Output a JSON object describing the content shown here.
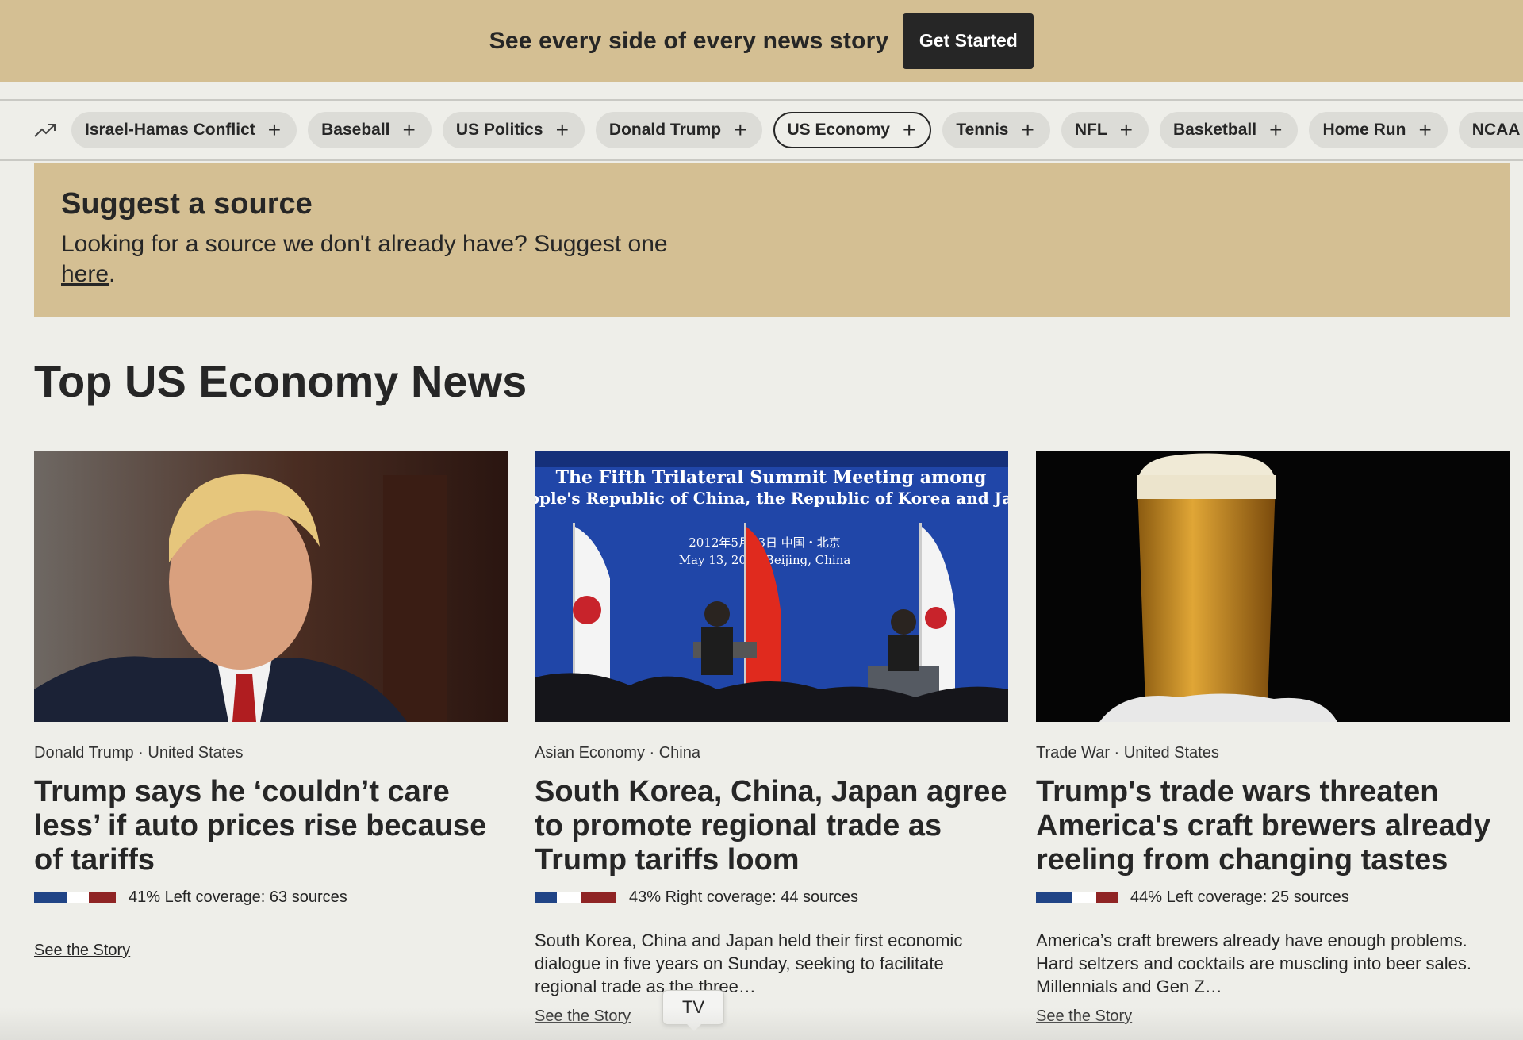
{
  "banner": {
    "text": "See every side of every news story",
    "button_label": "Get Started"
  },
  "topics": [
    {
      "label": "Israel-Hamas Conflict",
      "active": false
    },
    {
      "label": "Baseball",
      "active": false
    },
    {
      "label": "US Politics",
      "active": false
    },
    {
      "label": "Donald Trump",
      "active": false
    },
    {
      "label": "US Economy",
      "active": true
    },
    {
      "label": "Tennis",
      "active": false
    },
    {
      "label": "NFL",
      "active": false
    },
    {
      "label": "Basketball",
      "active": false
    },
    {
      "label": "Home Run",
      "active": false
    },
    {
      "label": "NCAA",
      "active": false
    }
  ],
  "suggest": {
    "title": "Suggest a source",
    "body_prefix": "Looking for a source we don't already have? Suggest one ",
    "link_text": "here",
    "body_suffix": "."
  },
  "section_title": "Top US Economy News",
  "cards": [
    {
      "meta": "Donald Trump · United States",
      "title": "Trump says he ‘couldn’t care less’ if auto prices rise because of tariffs",
      "coverage": "41% Left coverage: 63 sources",
      "bias": {
        "left": 0.41,
        "center": 0.26,
        "right": 0.33
      },
      "description": "",
      "link": "See the Story"
    },
    {
      "meta": "Asian Economy · China",
      "title": "South Korea, China, Japan agree to promote regional trade as Trump tariffs loom",
      "coverage": "43% Right coverage: 44 sources",
      "bias": {
        "left": 0.27,
        "center": 0.3,
        "right": 0.43
      },
      "description": "South Korea, China and Japan held their first economic dialogue in five years on Sunday, seeking to facilitate regional trade as the three…",
      "image_banner_line1": "The Fifth Trilateral Summit Meeting among",
      "image_banner_line2": "eople's Republic of China, the Republic of Korea and Jap",
      "image_date_cn": "2012年5月13日   中国・北京",
      "image_date_en": "May 13, 2012   Beijing, China",
      "link": "See the Story"
    },
    {
      "meta": "Trade War · United States",
      "title": "Trump's trade wars threaten America's craft brewers already reeling from changing tastes",
      "coverage": "44% Left coverage: 25 sources",
      "bias": {
        "left": 0.44,
        "center": 0.3,
        "right": 0.26
      },
      "description": "America’s craft brewers already have enough problems. Hard seltzers and cocktails are muscling into beer sales. Millennials and Gen Z…",
      "link": "See the Story"
    }
  ],
  "tooltip": "TV",
  "colors": {
    "banner_bg": "#d4bf93",
    "page_bg": "#eeeee9",
    "bias_left": "#204486",
    "bias_center": "#ffffff",
    "bias_right": "#8f2424"
  }
}
